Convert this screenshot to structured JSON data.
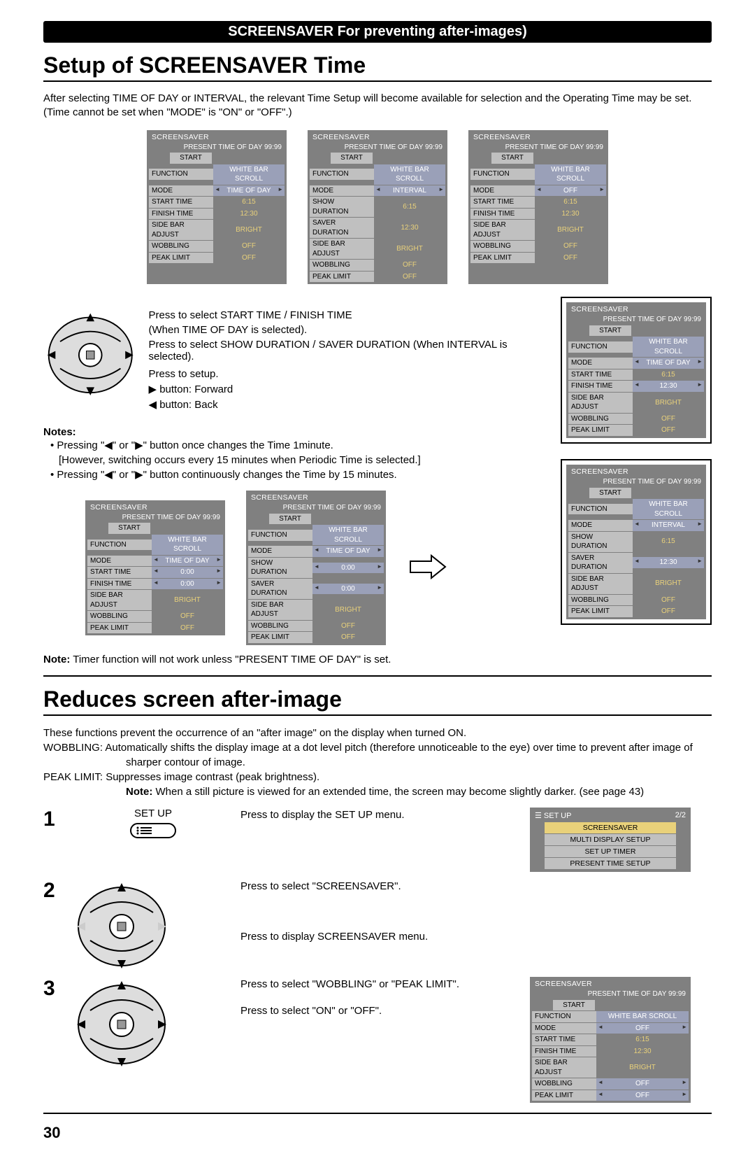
{
  "header": "SCREENSAVER For preventing after-images)",
  "sectionA": {
    "title": "Setup of SCREENSAVER Time",
    "intro": "After selecting TIME OF DAY or INTERVAL, the relevant Time Setup will become available for selection and the Operating Time may be set. (Time cannot be set when \"MODE\" is \"ON\" or \"OFF\".)",
    "menus_top": [
      {
        "mode": "TIME OF DAY",
        "rows": [
          [
            "START TIME",
            "6:15"
          ],
          [
            "FINISH TIME",
            "12:30"
          ]
        ]
      },
      {
        "mode": "INTERVAL",
        "rows": [
          [
            "SHOW DURATION",
            "6:15"
          ],
          [
            "SAVER DURATION",
            "12:30"
          ]
        ]
      },
      {
        "mode": "OFF",
        "rows": [
          [
            "START TIME",
            "6:15"
          ],
          [
            "FINISH TIME",
            "12:30"
          ]
        ]
      }
    ],
    "menu_common": {
      "title": "SCREENSAVER",
      "present": "PRESENT  TIME OF DAY    99:99",
      "start": "START",
      "function_label": "FUNCTION",
      "function_value": "WHITE BAR SCROLL",
      "mode_label": "MODE",
      "sidebar_label": "SIDE BAR ADJUST",
      "sidebar_value": "BRIGHT",
      "wobbling_label": "WOBBLING",
      "wobbling_value": "OFF",
      "peak_label": "PEAK LIMIT",
      "peak_value": "OFF"
    },
    "instr": {
      "l1": "Press to select START TIME / FINISH TIME",
      "l2": "(When TIME OF DAY is selected).",
      "l3": "Press to select SHOW DURATION / SAVER DURATION (When INTERVAL is selected).",
      "l4": "Press to setup.",
      "l5": "▶ button: Forward",
      "l6": "◀ button: Back"
    },
    "notes_head": "Notes:",
    "note1": "• Pressing \"◀\" or \"▶\" button once changes the Time 1minute.",
    "note1b": "[However, switching occurs every 15 minutes when Periodic Time is selected.]",
    "note2": "• Pressing \"◀\" or \"▶\" button continuously changes the Time by 15 minutes.",
    "menus_bottom": [
      {
        "mode": "TIME OF DAY",
        "rows": [
          [
            "START TIME",
            "0:00"
          ],
          [
            "FINISH TIME",
            "0:00"
          ]
        ]
      },
      {
        "mode": "TIME OF DAY",
        "rows": [
          [
            "SHOW DURATION",
            "0:00"
          ],
          [
            "SAVER DURATION",
            "0:00"
          ]
        ]
      }
    ],
    "framed_menus": [
      {
        "mode": "TIME OF DAY",
        "rows": [
          [
            "START TIME",
            "6:15"
          ],
          [
            "FINISH TIME",
            "12:30"
          ]
        ],
        "hrow": "FINISH TIME"
      },
      {
        "mode": "INTERVAL",
        "rows": [
          [
            "SHOW DURATION",
            "6:15"
          ],
          [
            "SAVER DURATION",
            "12:30"
          ]
        ],
        "hrow": "SAVER DURATION"
      }
    ],
    "timer_note": "Note: Timer function will not work unless \"PRESENT TIME OF DAY\" is set."
  },
  "sectionB": {
    "title": "Reduces screen after-image",
    "intro": "These functions prevent the occurrence of an \"after image\" on the display when turned ON.",
    "wob": "WOBBLING: Automatically shifts the display image at a dot level pitch (therefore unnoticeable to the eye) over time to prevent after image of sharper contour of image.",
    "peak": "PEAK LIMIT: Suppresses image contrast (peak brightness).",
    "peak_note": "Note: When a still picture is viewed for an extended time, the screen may become slightly darker. (see page 43)",
    "steps": {
      "s1_vis_label": "SET UP",
      "s1_text": "Press to display the SET UP menu.",
      "s2_text1": "Press to select \"SCREENSAVER\".",
      "s2_text2": "Press to display SCREENSAVER menu.",
      "s3_text1": "Press to select \"WOBBLING\" or \"PEAK LIMIT\".",
      "s3_text2": "Press to select \"ON\" or \"OFF\"."
    },
    "setup_menu": {
      "title": "SET UP",
      "page": "2/2",
      "items": [
        "SCREENSAVER",
        "MULTI DISPLAY SETUP",
        "SET UP TIMER",
        "PRESENT TIME SETUP"
      ]
    },
    "ss_menu": {
      "mode": "OFF",
      "rows": [
        [
          "START TIME",
          "6:15"
        ],
        [
          "FINISH TIME",
          "12:30"
        ]
      ]
    }
  },
  "page_number": "30"
}
